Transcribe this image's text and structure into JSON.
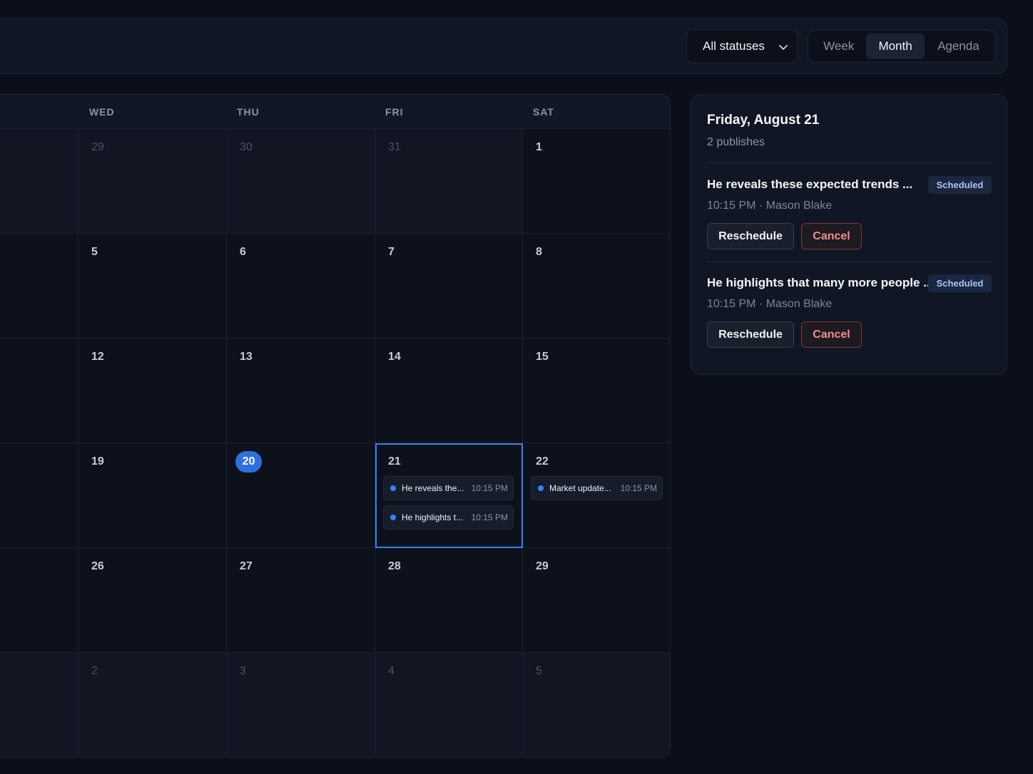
{
  "toolbar": {
    "status_filter": "All statuses",
    "views": [
      "Week",
      "Month",
      "Agenda"
    ],
    "active_view": "Month"
  },
  "calendar": {
    "weekdays": [
      "WED",
      "THU",
      "FRI",
      "SAT"
    ],
    "weeks": [
      [
        {
          "d": "29",
          "muted": true
        },
        {
          "d": "30",
          "muted": true
        },
        {
          "d": "31",
          "muted": true
        },
        {
          "d": "1"
        }
      ],
      [
        {
          "d": "5"
        },
        {
          "d": "6"
        },
        {
          "d": "7"
        },
        {
          "d": "8"
        }
      ],
      [
        {
          "d": "12"
        },
        {
          "d": "13"
        },
        {
          "d": "14"
        },
        {
          "d": "15"
        }
      ],
      [
        {
          "d": "19"
        },
        {
          "d": "20",
          "today": true
        },
        {
          "d": "21",
          "selected": true,
          "events": [
            {
              "title": "He reveals the...",
              "time": "10:15 PM"
            },
            {
              "title": "He highlights t...",
              "time": "10:15 PM"
            }
          ]
        },
        {
          "d": "22",
          "events": [
            {
              "title": "Market update...",
              "time": "10:15 PM"
            }
          ]
        }
      ],
      [
        {
          "d": "26"
        },
        {
          "d": "27"
        },
        {
          "d": "28"
        },
        {
          "d": "29"
        }
      ],
      [
        {
          "d": "2",
          "muted": true
        },
        {
          "d": "3",
          "muted": true
        },
        {
          "d": "4",
          "muted": true
        },
        {
          "d": "5",
          "muted": true
        }
      ]
    ],
    "event_dot_color": "#3b82f6",
    "today_color": "#2f6fe0"
  },
  "detail": {
    "title": "Friday, August 21",
    "subtitle": "2 publishes",
    "items": [
      {
        "title": "He reveals these expected trends ...",
        "status": "Scheduled",
        "meta": "10:15 PM · Mason Blake",
        "reschedule": "Reschedule",
        "cancel": "Cancel"
      },
      {
        "title": "He highlights that many more people ...",
        "status": "Scheduled",
        "meta": "10:15 PM · Mason Blake",
        "reschedule": "Reschedule",
        "cancel": "Cancel"
      }
    ]
  }
}
